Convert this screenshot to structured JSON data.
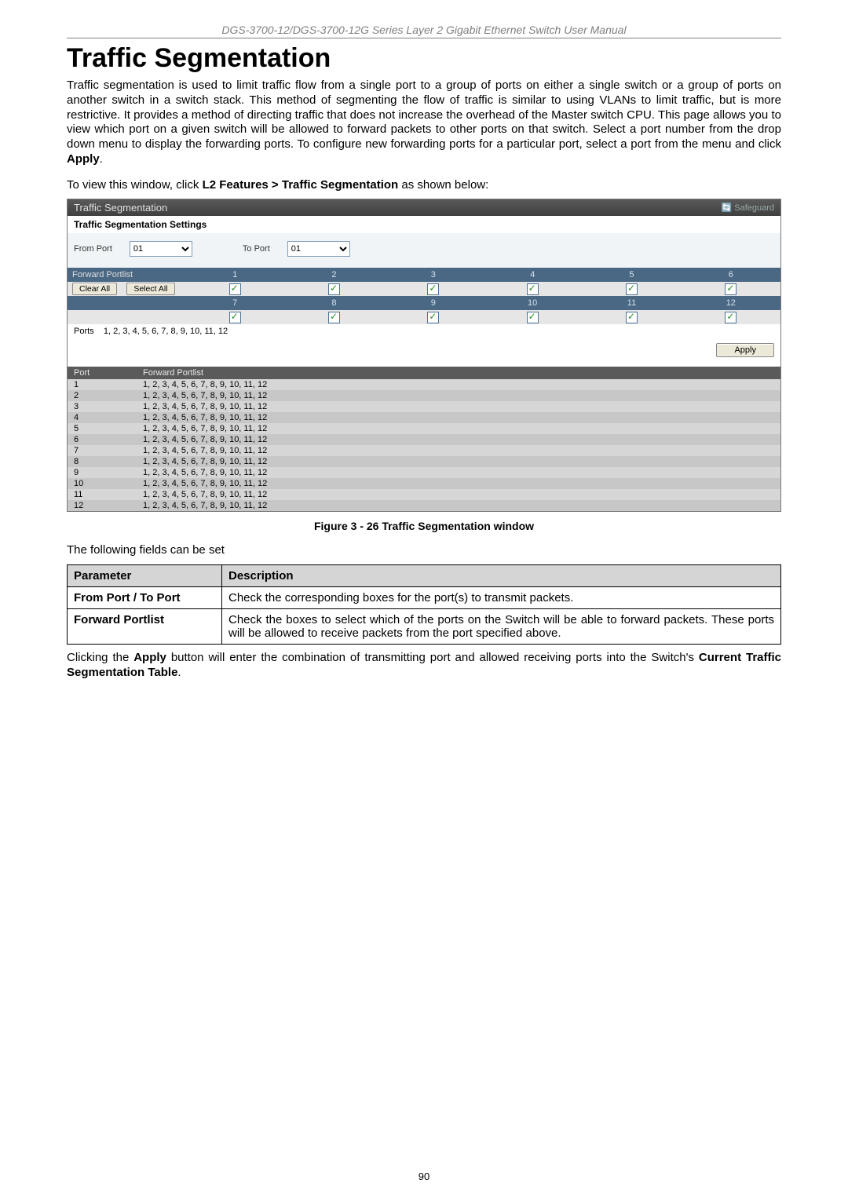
{
  "header": "DGS-3700-12/DGS-3700-12G Series Layer 2 Gigabit Ethernet Switch User Manual",
  "h1": "Traffic Segmentation",
  "intro": "Traffic segmentation is used to limit traffic flow from a single port to a group of ports on either a single switch or a group of ports on another switch in a switch stack. This method of segmenting the flow of traffic is similar to using VLANs to limit traffic, but is more restrictive. It provides a method of directing traffic that does not increase the overhead of the Master switch CPU. This page allows you to view which port on a given switch will be allowed to forward packets to other ports on that switch. Select a port number from the drop down menu to display the forwarding ports. To configure new forwarding ports for a particular port, select a port from the menu and click ",
  "intro_bold": "Apply",
  "nav_line_pre": "To view this window, click ",
  "nav_line_bold": "L2 Features > Traffic Segmentation",
  "nav_line_post": " as shown below:",
  "shot": {
    "title": "Traffic Segmentation",
    "safeguard": "Safeguard",
    "section": "Traffic Segmentation Settings",
    "from_label": "From Port",
    "to_label": "To Port",
    "from_val": "01",
    "to_val": "01",
    "fp_label": "Forward Portlist",
    "clear_btn": "Clear All",
    "select_btn": "Select All",
    "row1": [
      "1",
      "2",
      "3",
      "4",
      "5",
      "6"
    ],
    "row2": [
      "7",
      "8",
      "9",
      "10",
      "11",
      "12"
    ],
    "ports_label": "Ports",
    "ports_val": "1, 2, 3, 4, 5, 6, 7, 8, 9, 10, 11, 12",
    "apply": "Apply",
    "table_h1": "Port",
    "table_h2": "Forward Portlist",
    "table_rows": [
      {
        "p": "1",
        "v": "1, 2, 3, 4, 5, 6, 7, 8, 9, 10, 11, 12"
      },
      {
        "p": "2",
        "v": "1, 2, 3, 4, 5, 6, 7, 8, 9, 10, 11, 12"
      },
      {
        "p": "3",
        "v": "1, 2, 3, 4, 5, 6, 7, 8, 9, 10, 11, 12"
      },
      {
        "p": "4",
        "v": "1, 2, 3, 4, 5, 6, 7, 8, 9, 10, 11, 12"
      },
      {
        "p": "5",
        "v": "1, 2, 3, 4, 5, 6, 7, 8, 9, 10, 11, 12"
      },
      {
        "p": "6",
        "v": "1, 2, 3, 4, 5, 6, 7, 8, 9, 10, 11, 12"
      },
      {
        "p": "7",
        "v": "1, 2, 3, 4, 5, 6, 7, 8, 9, 10, 11, 12"
      },
      {
        "p": "8",
        "v": "1, 2, 3, 4, 5, 6, 7, 8, 9, 10, 11, 12"
      },
      {
        "p": "9",
        "v": "1, 2, 3, 4, 5, 6, 7, 8, 9, 10, 11, 12"
      },
      {
        "p": "10",
        "v": "1, 2, 3, 4, 5, 6, 7, 8, 9, 10, 11, 12"
      },
      {
        "p": "11",
        "v": "1, 2, 3, 4, 5, 6, 7, 8, 9, 10, 11, 12"
      },
      {
        "p": "12",
        "v": "1, 2, 3, 4, 5, 6, 7, 8, 9, 10, 11, 12"
      }
    ]
  },
  "figcap": "Figure 3 - 26 Traffic Segmentation window",
  "fields_line": "The following fields can be set",
  "params": {
    "h1": "Parameter",
    "h2": "Description",
    "rows": [
      {
        "k": "From Port / To Port",
        "v": "Check the corresponding boxes for the port(s) to transmit packets."
      },
      {
        "k": "Forward Portlist",
        "v": "Check the boxes to select which of the ports on the Switch will be able to forward packets. These ports will be allowed to receive packets from the port specified above."
      }
    ]
  },
  "foot_pre": "Clicking the ",
  "foot_b1": "Apply",
  "foot_mid": " button will enter the combination of transmitting port and allowed receiving ports into the Switch's ",
  "foot_b2": "Current Traffic Segmentation Table",
  "foot_post": ".",
  "pagenum": "90"
}
